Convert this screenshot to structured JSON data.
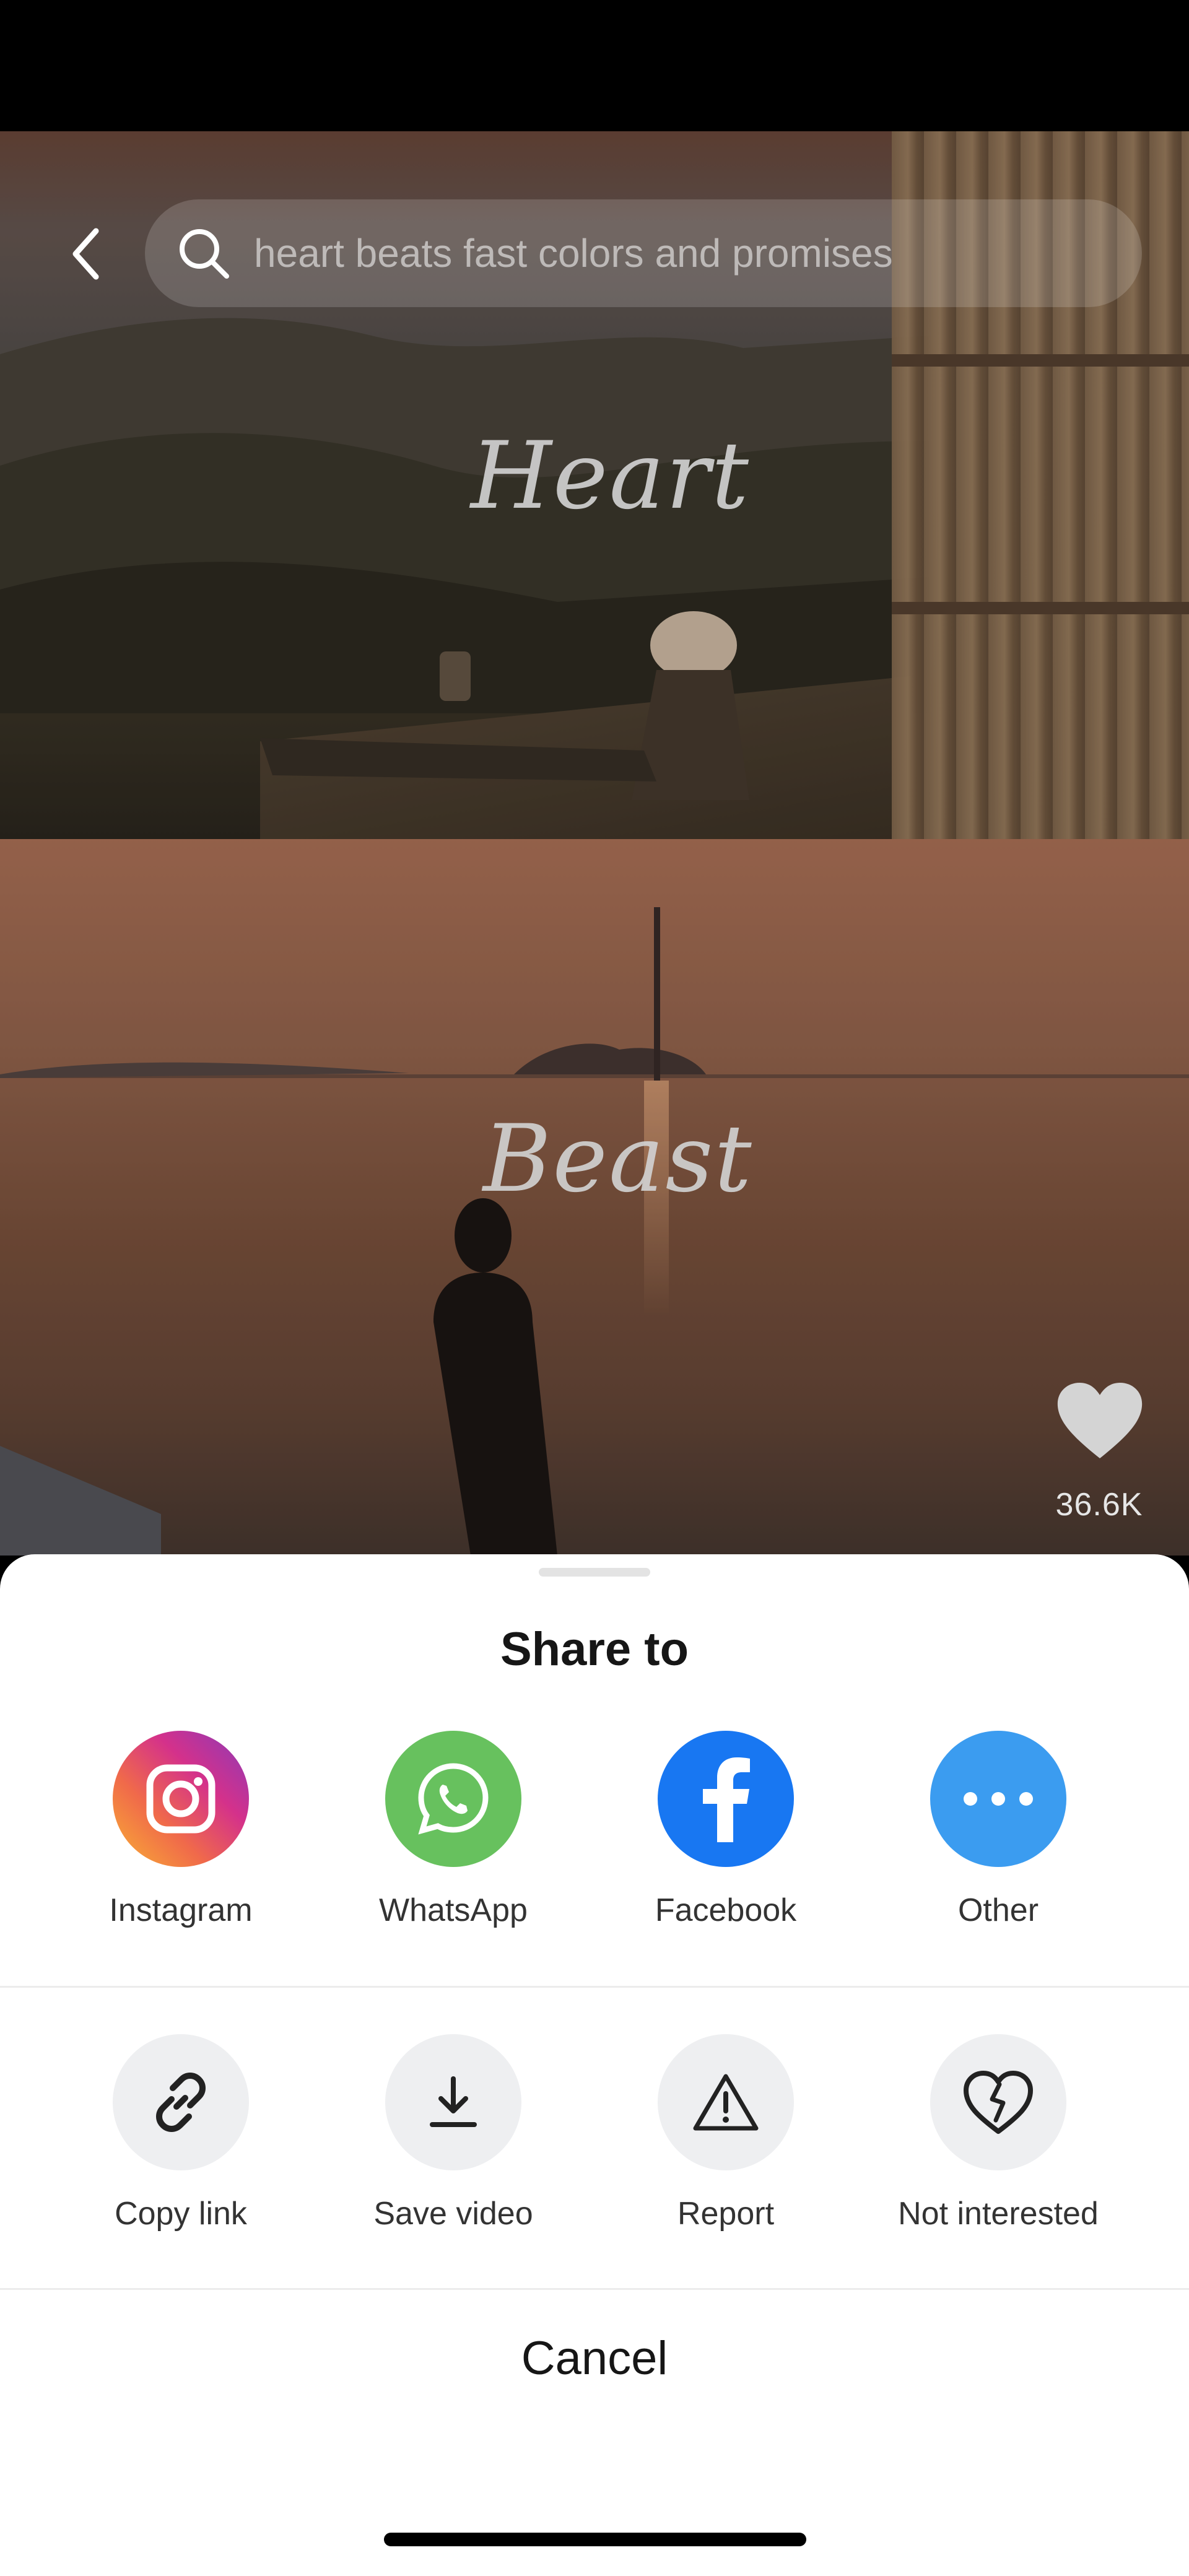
{
  "search": {
    "query": "heart beats fast colors and promises"
  },
  "video": {
    "overlay_text_1": "Heart",
    "overlay_text_2": "Beast",
    "like_count": "36.6K"
  },
  "share_sheet": {
    "title": "Share to",
    "apps": [
      {
        "label": "Instagram",
        "icon": "instagram-icon"
      },
      {
        "label": "WhatsApp",
        "icon": "whatsapp-icon"
      },
      {
        "label": "Facebook",
        "icon": "facebook-icon"
      },
      {
        "label": "Other",
        "icon": "more-dots-icon"
      }
    ],
    "actions": [
      {
        "label": "Copy link",
        "icon": "link-icon"
      },
      {
        "label": "Save video",
        "icon": "download-icon"
      },
      {
        "label": "Report",
        "icon": "warning-icon"
      },
      {
        "label": "Not interested",
        "icon": "broken-heart-icon"
      }
    ],
    "cancel_label": "Cancel"
  },
  "colors": {
    "facebook": "#1877f2",
    "whatsapp": "#67c15e",
    "other": "#3b9cf0",
    "sheet_background": "#ffffff"
  }
}
